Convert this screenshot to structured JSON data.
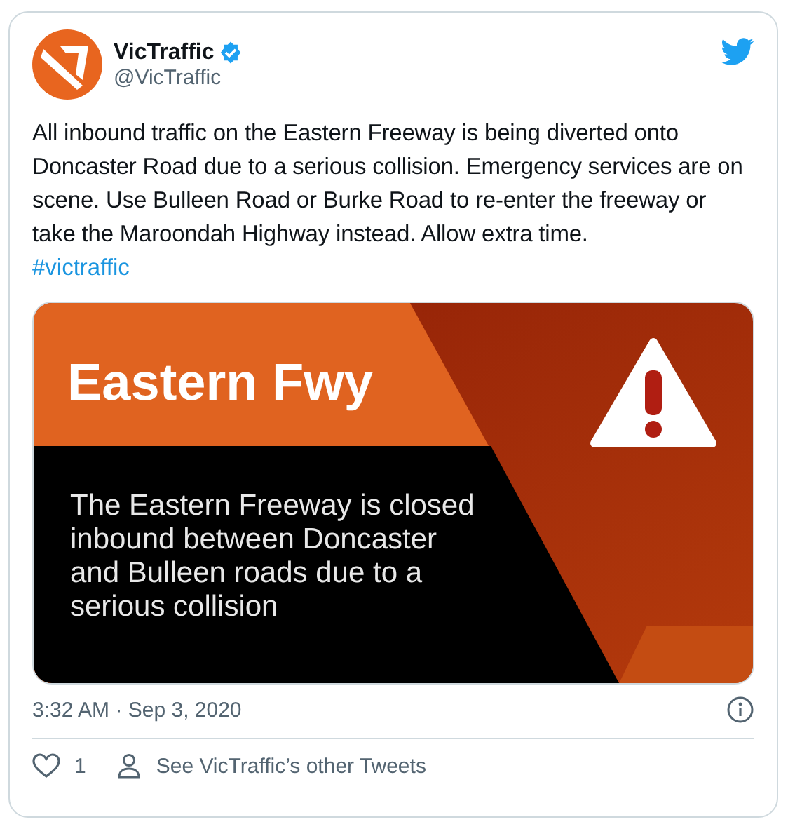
{
  "author": {
    "name": "VicTraffic",
    "verified": true,
    "handle": "@VicTraffic"
  },
  "tweet": {
    "text": "All inbound traffic on the Eastern Freeway is being diverted onto Doncaster Road due to a serious collision. Emergency services are on scene. Use Bulleen Road or Burke Road to re-enter the freeway or take the Maroondah Highway instead. Allow extra time.",
    "hashtag": "#victraffic"
  },
  "banner": {
    "title": "Eastern Fwy",
    "body": "The Eastern Freeway is closed inbound between Doncaster and Bulleen roads due to a serious collision"
  },
  "timestamp": "3:32 AM · Sep 3, 2020",
  "footer": {
    "likes": "1",
    "link": "See VicTraffic’s other Tweets"
  }
}
